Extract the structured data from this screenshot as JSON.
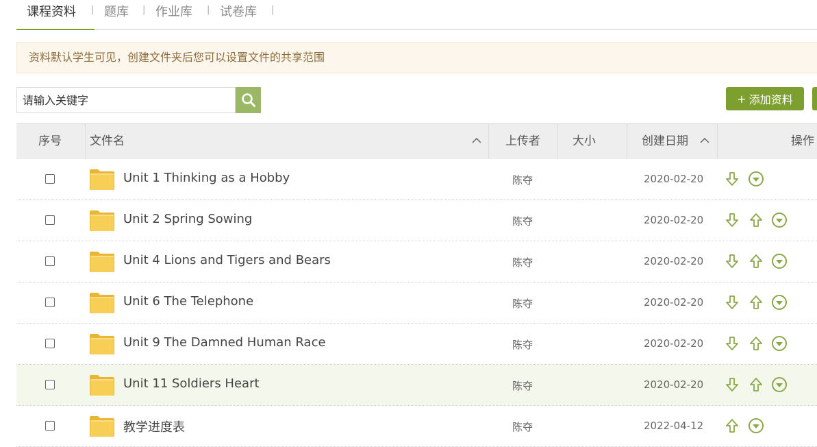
{
  "tabs": [
    {
      "label": "课程资料"
    },
    {
      "label": "题库"
    },
    {
      "label": "作业库"
    },
    {
      "label": "试卷库"
    }
  ],
  "tab_separator": "|",
  "notice": "资料默认学生可见，创建文件夹后您可以设置文件的共享范围",
  "search": {
    "placeholder": "请输入关键字"
  },
  "add_button": {
    "plus": "+",
    "label": "添加资料"
  },
  "table": {
    "headers": {
      "index": "序号",
      "filename": "文件名",
      "uploader": "上传者",
      "size": "大小",
      "created": "创建日期",
      "actions": "操作"
    },
    "rows": [
      {
        "name": "Unit 1 Thinking as a Hobby",
        "uploader": "陈夺",
        "size": "",
        "date": "2020-02-20"
      },
      {
        "name": "Unit 2 Spring Sowing",
        "uploader": "陈夺",
        "size": "",
        "date": "2020-02-20"
      },
      {
        "name": "Unit 4 Lions and Tigers and Bears",
        "uploader": "陈夺",
        "size": "",
        "date": "2020-02-20"
      },
      {
        "name": "Unit 6 The Telephone",
        "uploader": "陈夺",
        "size": "",
        "date": "2020-02-20"
      },
      {
        "name": "Unit 9 The Damned Human Race",
        "uploader": "陈夺",
        "size": "",
        "date": "2020-02-20"
      },
      {
        "name": "Unit 11 Soldiers Heart",
        "uploader": "陈夺",
        "size": "",
        "date": "2020-02-20"
      },
      {
        "name": "教学进度表",
        "uploader": "陈夺",
        "size": "",
        "date": "2022-04-12"
      }
    ]
  },
  "colors": {
    "accent": "#7c9f2f",
    "notice_bg": "#fdf6ec",
    "folder": "#f7cf57"
  },
  "icons": [
    "search-icon",
    "folder-icon",
    "move-down-icon",
    "move-up-icon",
    "more-options-icon",
    "sort-icon"
  ]
}
